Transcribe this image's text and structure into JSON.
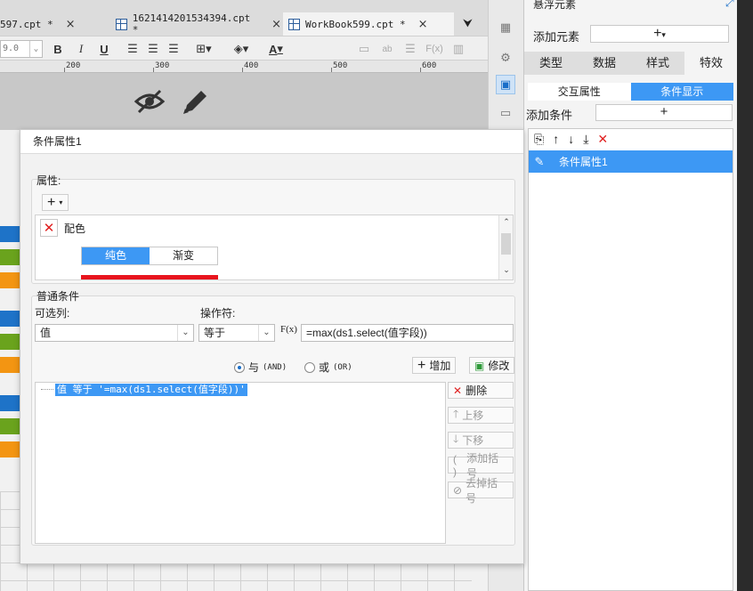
{
  "tabs": [
    {
      "label": "597.cpt *",
      "active": false
    },
    {
      "label": "1621414201534394.cpt *",
      "active": false
    },
    {
      "label": "WorkBook599.cpt *",
      "active": true
    }
  ],
  "toolbar": {
    "font_size": "9.0",
    "bold": "B",
    "italic": "I",
    "underline": "U",
    "font_color": "A",
    "formula": "F(x)"
  },
  "ruler": {
    "marks": [
      "200",
      "300",
      "400",
      "500",
      "600"
    ]
  },
  "right_panel": {
    "title": "悬浮元素",
    "add_element_label": "添加元素",
    "add_element_button": "+",
    "tabs": [
      "类型",
      "数据",
      "样式",
      "特效"
    ],
    "active_tab": "特效",
    "sub_tabs": [
      "交互属性",
      "条件显示"
    ],
    "active_sub_tab": "条件显示",
    "add_condition_label": "添加条件",
    "add_condition_button": "+",
    "condition_items": [
      "条件属性1"
    ]
  },
  "dialog": {
    "title": "条件属性1",
    "attr_section": "属性:",
    "attr_add": "+",
    "attr_item_label": "配色",
    "color_modes": [
      "纯色",
      "渐变"
    ],
    "active_color_mode": "纯色",
    "fill_color": "#e8141d",
    "general_section": "普通条件",
    "column_label": "可选列:",
    "operator_label": "操作符:",
    "column_value": "值",
    "operator_value": "等于",
    "formula_icon_label": "F(x)",
    "formula_value": "=max(ds1.select(值字段))",
    "and_label": "与",
    "and_sub": "(AND)",
    "or_label": "或",
    "or_sub": "(OR)",
    "add_button": "增加",
    "modify_button": "修改",
    "delete_button": "删除",
    "up_button": "上移",
    "down_button": "下移",
    "add_bracket_button": "添加括号",
    "remove_bracket_button": "去掉括号",
    "condition_expression": "值 等于 '=max(ds1.select(值字段))'"
  },
  "colors": {
    "accent": "#3d98f4",
    "bar_blue": "#1e73c8",
    "bar_green": "#6aa31d",
    "bar_orange": "#f39512"
  }
}
